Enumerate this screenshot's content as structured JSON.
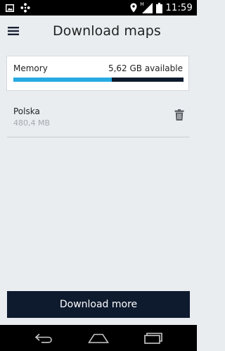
{
  "status_bar": {
    "time": "11:59",
    "network_type": "H",
    "left_icons": [
      "image-notification-icon",
      "app-notification-icon"
    ],
    "right_icons": [
      "location-icon",
      "signal-icon",
      "battery-icon"
    ]
  },
  "header": {
    "title": "Download maps",
    "menu_icon": "hamburger-menu-icon"
  },
  "memory": {
    "label": "Memory",
    "available": "5,62 GB available",
    "used_fraction": 0.58
  },
  "maps": [
    {
      "name": "Polska",
      "size": "480,4 MB",
      "action_icon": "trash-icon"
    }
  ],
  "actions": {
    "download_more": "Download more"
  },
  "nav_bar": {
    "buttons": [
      "back-icon",
      "home-icon",
      "recents-icon"
    ]
  },
  "colors": {
    "background": "#e9edf0",
    "accent": "#27a9e1",
    "dark": "#0e1a2e"
  }
}
